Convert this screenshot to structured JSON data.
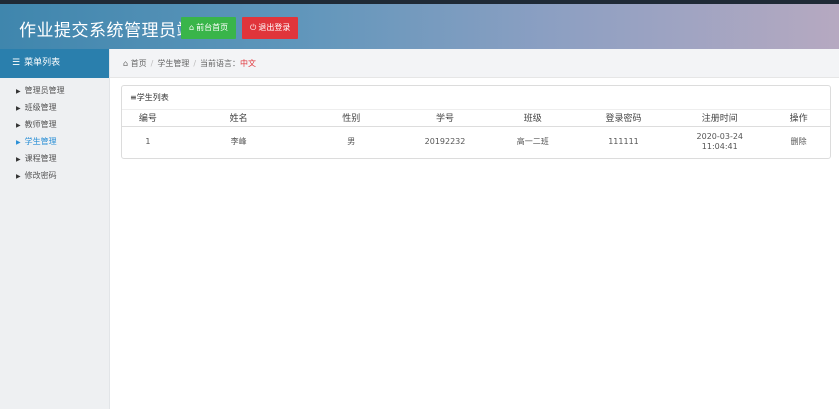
{
  "header": {
    "title": "作业提交系统管理员端",
    "home_button": "前台首页",
    "logout_button": "退出登录"
  },
  "sidebar": {
    "heading": "菜单列表",
    "items": [
      {
        "label": "管理员管理",
        "active": false
      },
      {
        "label": "班级管理",
        "active": false
      },
      {
        "label": "教师管理",
        "active": false
      },
      {
        "label": "学生管理",
        "active": true
      },
      {
        "label": "课程管理",
        "active": false
      },
      {
        "label": "修改密码",
        "active": false
      }
    ]
  },
  "breadcrumb": {
    "home": "首页",
    "section": "学生管理",
    "lang_label": "当前语言：",
    "lang_value": "中文"
  },
  "panel": {
    "title": "学生列表",
    "columns": [
      "编号",
      "姓名",
      "性别",
      "学号",
      "班级",
      "登录密码",
      "注册时间",
      "操作"
    ],
    "rows": [
      {
        "id": "1",
        "name": "李峰",
        "gender": "男",
        "student_no": "20192232",
        "class": "高一二班",
        "password": "111111",
        "reg_date": "2020-03-24",
        "reg_time": "11:04:41",
        "action": "删除"
      }
    ]
  },
  "colors": {
    "accent": "#2a7fad",
    "active_menu": "#2a8fd6",
    "home_button": "#39b54a",
    "logout_button": "#e0353b"
  },
  "icons": {
    "home": "home-icon",
    "logout": "power-icon",
    "menu": "list-icon",
    "breadcrumb_home": "home-icon",
    "panel": "list-icon",
    "menu_bullet": "caret-right-icon"
  }
}
